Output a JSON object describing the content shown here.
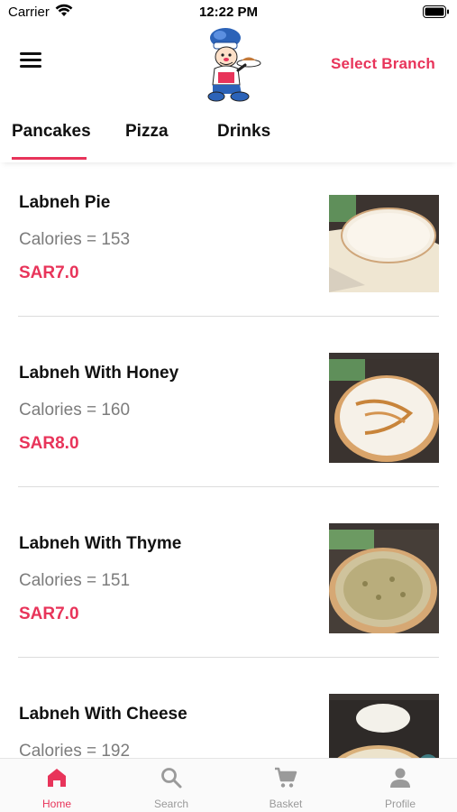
{
  "status_bar": {
    "carrier": "Carrier",
    "time": "12:22 PM"
  },
  "header": {
    "select_branch_label": "Select Branch",
    "menu_icon": "hamburger-icon",
    "logo": "chef-mascot-logo"
  },
  "tabs": [
    {
      "label": "Pancakes",
      "active": true
    },
    {
      "label": "Pizza",
      "active": false
    },
    {
      "label": "Drinks",
      "active": false
    }
  ],
  "menu_items": [
    {
      "name": "Labneh Pie",
      "calories": "Calories = 153",
      "price": "SAR7.0"
    },
    {
      "name": "Labneh With Honey",
      "calories": "Calories = 160",
      "price": "SAR8.0"
    },
    {
      "name": "Labneh With Thyme",
      "calories": "Calories = 151",
      "price": "SAR7.0"
    },
    {
      "name": "Labneh With Cheese",
      "calories": "Calories = 192",
      "price": ""
    }
  ],
  "bottom_nav": [
    {
      "label": "Home",
      "icon": "home-icon",
      "active": true
    },
    {
      "label": "Search",
      "icon": "search-icon",
      "active": false
    },
    {
      "label": "Basket",
      "icon": "cart-icon",
      "active": false
    },
    {
      "label": "Profile",
      "icon": "person-icon",
      "active": false
    }
  ],
  "colors": {
    "accent": "#e8345a",
    "text_primary": "#111111",
    "text_secondary": "#7c7c7c",
    "nav_inactive": "#9a9a9a"
  }
}
